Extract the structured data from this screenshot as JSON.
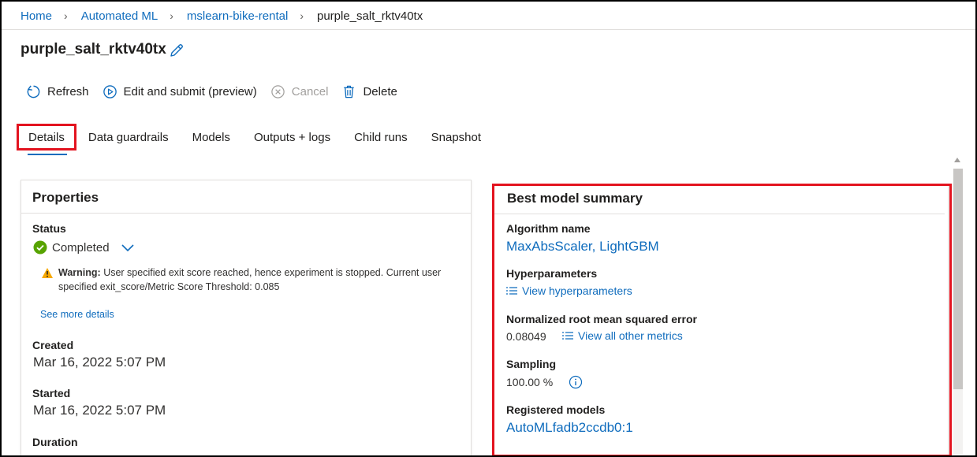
{
  "breadcrumb": {
    "items": [
      "Home",
      "Automated ML",
      "mslearn-bike-rental"
    ],
    "current": "purple_salt_rktv40tx"
  },
  "title": "purple_salt_rktv40tx",
  "toolbar": {
    "refresh": "Refresh",
    "edit_submit": "Edit and submit (preview)",
    "cancel": "Cancel",
    "delete": "Delete"
  },
  "tabs": [
    "Details",
    "Data guardrails",
    "Models",
    "Outputs + logs",
    "Child runs",
    "Snapshot"
  ],
  "properties": {
    "title": "Properties",
    "status_label": "Status",
    "status_value": "Completed",
    "warning_prefix": "Warning:",
    "warning_text": "User specified exit score reached, hence experiment is stopped. Current user specified exit_score/Metric Score Threshold: 0.085",
    "see_more": "See more details",
    "created_label": "Created",
    "created_value": "Mar 16, 2022 5:07 PM",
    "started_label": "Started",
    "started_value": "Mar 16, 2022 5:07 PM",
    "duration_label": "Duration"
  },
  "best_model": {
    "title": "Best model summary",
    "algorithm_label": "Algorithm name",
    "algorithm_value": "MaxAbsScaler, LightGBM",
    "hyper_label": "Hyperparameters",
    "hyper_link": "View hyperparameters",
    "nrmse_label": "Normalized root mean squared error",
    "nrmse_value": "0.08049",
    "metrics_link": "View all other metrics",
    "sampling_label": "Sampling",
    "sampling_value": "100.00 %",
    "registered_label": "Registered models",
    "registered_value": "AutoMLfadb2ccdb0:1"
  },
  "colors": {
    "accent": "#0f6cbd",
    "highlight": "#e3131f",
    "success": "#57a300",
    "warning": "#f7a800"
  }
}
